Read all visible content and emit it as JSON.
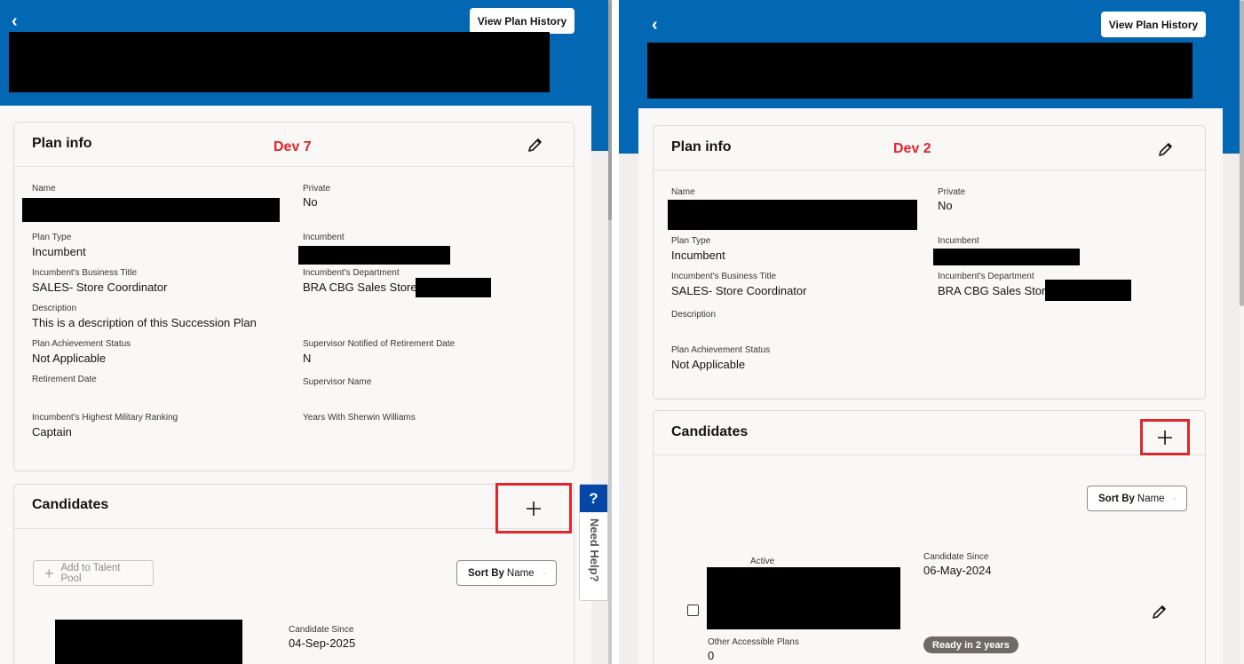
{
  "left": {
    "header": {
      "history_label": "View Plan History"
    },
    "plan_info": {
      "title": "Plan info",
      "dev_tag": "Dev 7",
      "fields": {
        "name_label": "Name",
        "private_label": "Private",
        "private_value": "No",
        "plan_type_label": "Plan Type",
        "plan_type_value": "Incumbent",
        "incumbent_label": "Incumbent",
        "biz_title_label": "Incumbent's Business Title",
        "biz_title_value": "SALES- Store Coordinator",
        "dept_label": "Incumbent's Department",
        "dept_value": "BRA CBG Sales Store P",
        "desc_label": "Description",
        "desc_value": "This is a description of this Succession Plan",
        "achievement_label": "Plan Achievement Status",
        "achievement_value": "Not Applicable",
        "supervisor_notified_label": "Supervisor Notified of Retirement Date",
        "supervisor_notified_value": "N",
        "retirement_label": "Retirement Date",
        "supervisor_name_label": "Supervisor Name",
        "military_label": "Incumbent's Highest Military Ranking",
        "military_value": "Captain",
        "years_label": "Years With Sherwin Williams"
      }
    },
    "candidates": {
      "title": "Candidates",
      "add_talent_label": "Add to Talent Pool",
      "sort_prefix": "Sort By",
      "sort_value": "Name",
      "candidate_since_label": "Candidate Since",
      "candidate_since_value": "04-Sep-2025"
    }
  },
  "help": {
    "icon": "?",
    "label": "Need Help?"
  },
  "right": {
    "header": {
      "history_label": "View Plan History"
    },
    "plan_info": {
      "title": "Plan info",
      "dev_tag": "Dev 2",
      "fields": {
        "name_label": "Name",
        "private_label": "Private",
        "private_value": "No",
        "plan_type_label": "Plan Type",
        "plan_type_value": "Incumbent",
        "incumbent_label": "Incumbent",
        "biz_title_label": "Incumbent's Business Title",
        "biz_title_value": "SALES- Store Coordinator",
        "dept_label": "Incumbent's Department",
        "dept_value": "BRA CBG Sales Store",
        "desc_label": "Description",
        "achievement_label": "Plan Achievement Status",
        "achievement_value": "Not Applicable"
      }
    },
    "candidates": {
      "title": "Candidates",
      "sort_prefix": "Sort By",
      "sort_value": "Name",
      "status": "Active",
      "candidate_since_label": "Candidate Since",
      "candidate_since_value": "06-May-2024",
      "other_plans_label": "Other Accessible Plans",
      "other_plans_value": "0",
      "readiness_badge": "Ready in 2 years"
    }
  },
  "colors": {
    "brand_blue": "#0467b3",
    "highlight_red": "#e0262b",
    "help_blue": "#0447a6"
  },
  "icons": [
    "chevron-left-icon",
    "pencil-icon",
    "plus-icon",
    "chevron-down-icon",
    "question-icon"
  ]
}
